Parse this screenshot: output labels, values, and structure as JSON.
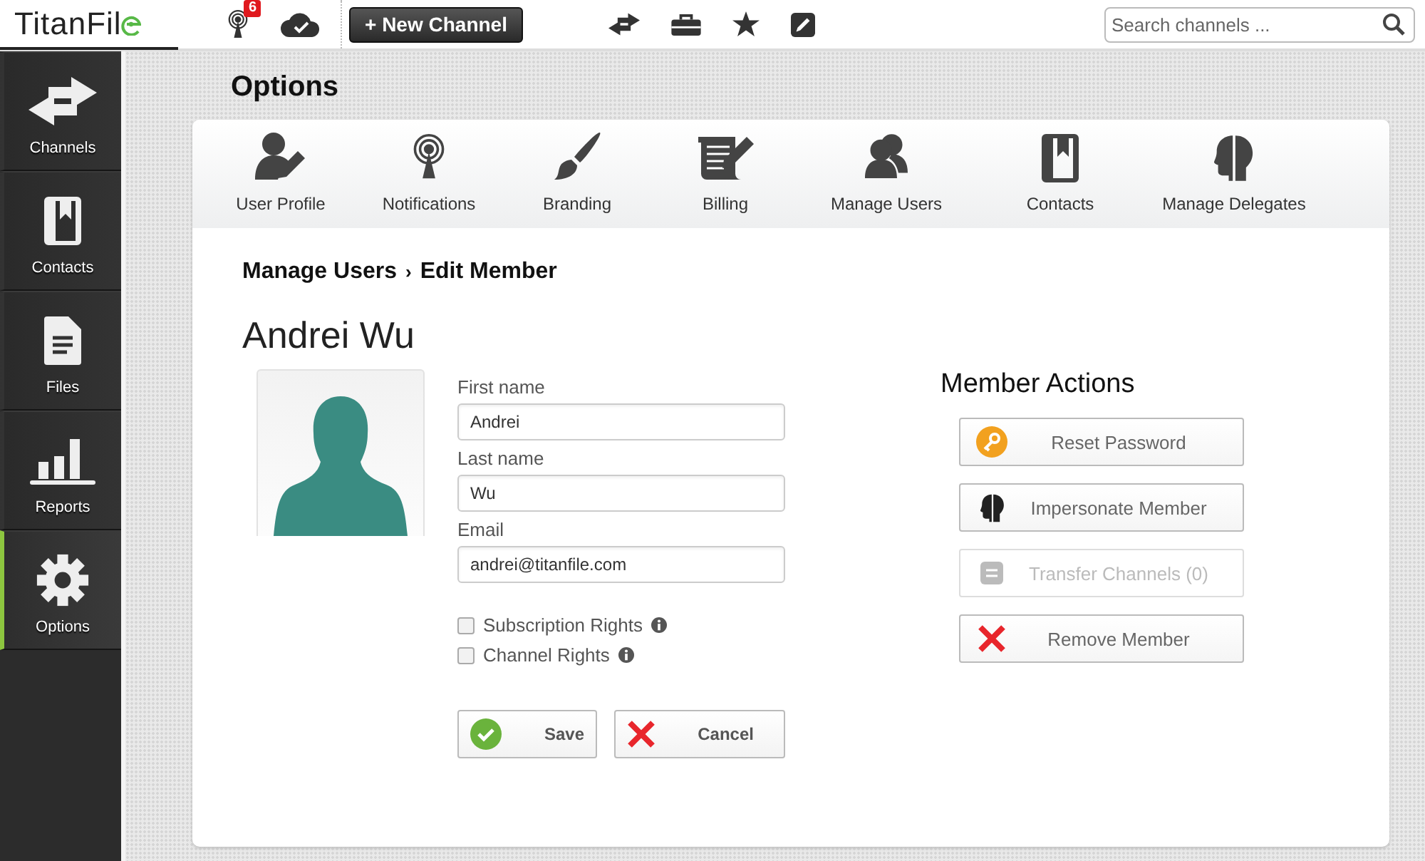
{
  "topbar": {
    "logo": "TitanFil",
    "notification_count": "6",
    "new_channel_button": "+ New Channel",
    "search": {
      "placeholder": "Search channels ..."
    }
  },
  "sidebar": {
    "items": [
      {
        "label": "Channels",
        "kind": "arrows",
        "selected": false
      },
      {
        "label": "Contacts",
        "kind": "book",
        "selected": false
      },
      {
        "label": "Files",
        "kind": "file",
        "selected": false
      },
      {
        "label": "Reports",
        "kind": "chart",
        "selected": false
      },
      {
        "label": "Options",
        "kind": "gear",
        "selected": true
      }
    ]
  },
  "page_title": "Options",
  "option_tabs": [
    {
      "label": "User Profile",
      "kind": "user-edit"
    },
    {
      "label": "Notifications",
      "kind": "antenna"
    },
    {
      "label": "Branding",
      "kind": "brush"
    },
    {
      "label": "Billing",
      "kind": "scroll"
    },
    {
      "label": "Manage Users",
      "kind": "users"
    },
    {
      "label": "Contacts",
      "kind": "book"
    },
    {
      "label": "Manage Delegates",
      "kind": "head"
    }
  ],
  "breadcrumb": {
    "parent": "Manage Users",
    "separator": "›",
    "current": "Edit Member"
  },
  "member_name": "Andrei Wu",
  "form": {
    "fields": [
      {
        "label": "First name",
        "value": "Andrei"
      },
      {
        "label": "Last name",
        "value": "Wu"
      },
      {
        "label": "Email",
        "value": "andrei@titanfile.com"
      }
    ],
    "checkboxes": [
      {
        "label": "Subscription Rights",
        "checked": false
      },
      {
        "label": "Channel Rights",
        "checked": false
      }
    ],
    "buttons": [
      {
        "label": "Save",
        "kind": "save"
      },
      {
        "label": "Cancel",
        "kind": "cancel"
      }
    ]
  },
  "member_actions": {
    "title": "Member Actions",
    "buttons": [
      {
        "label": "Reset Password",
        "kind": "key",
        "disabled": false
      },
      {
        "label": "Impersonate Member",
        "kind": "head",
        "disabled": false
      },
      {
        "label": "Transfer Channels (0)",
        "kind": "transfer",
        "disabled": true
      },
      {
        "label": "Remove Member",
        "kind": "remove",
        "disabled": false
      }
    ]
  }
}
